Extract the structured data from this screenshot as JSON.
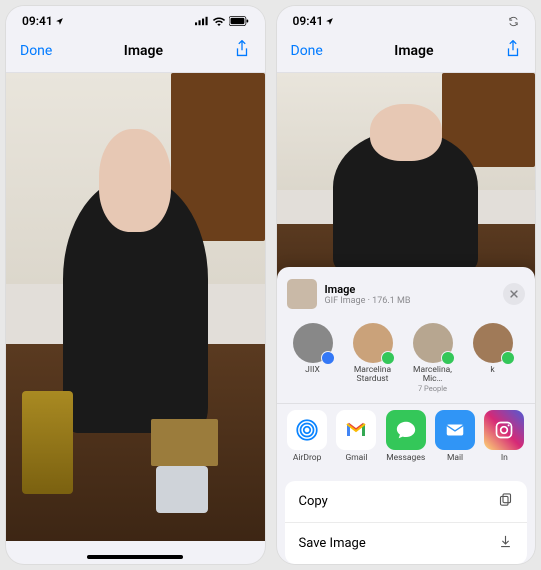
{
  "status_bar": {
    "time": "09:41"
  },
  "nav": {
    "done": "Done",
    "title": "Image"
  },
  "share_sheet": {
    "header_title": "Image",
    "header_subtitle": "GIF Image · 176.1 MB",
    "contacts": [
      {
        "name": "JIIX",
        "sub": "",
        "badge": "blue"
      },
      {
        "name": "Marcelina Stardust",
        "sub": "",
        "badge": "green"
      },
      {
        "name": "Marcelina, Mic…",
        "sub": "7 People",
        "badge": "green"
      },
      {
        "name": "k",
        "sub": "",
        "badge": "green"
      }
    ],
    "apps": [
      {
        "label": "AirDrop",
        "kind": "airdrop"
      },
      {
        "label": "Gmail",
        "kind": "gmail"
      },
      {
        "label": "Messages",
        "kind": "messages"
      },
      {
        "label": "Mail",
        "kind": "mail"
      },
      {
        "label": "In",
        "kind": "insta"
      }
    ],
    "actions": {
      "copy_label": "Copy",
      "save_label": "Save Image"
    }
  }
}
